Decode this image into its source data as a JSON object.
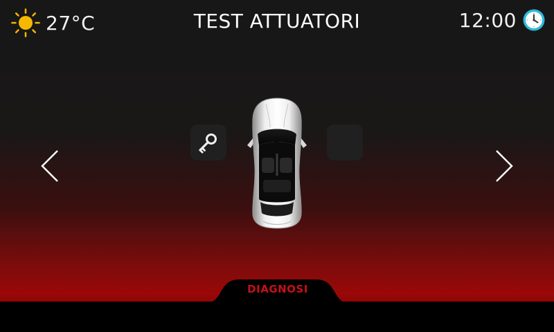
{
  "status": {
    "temperature": "27°C",
    "time": "12:00"
  },
  "header": {
    "title": "TEST ATTUATORI"
  },
  "footer": {
    "tab_label": "DIAGNOSI"
  },
  "icons": {
    "weather": "sun-icon",
    "clock": "clock-icon",
    "prev": "chevron-left-icon",
    "next": "chevron-right-icon",
    "actuator_left": "key-icon",
    "vehicle": "car-top-view"
  },
  "colors": {
    "accent_red": "#c81018",
    "sun_yellow": "#f5b800",
    "clock_cyan": "#2fb8d8"
  }
}
